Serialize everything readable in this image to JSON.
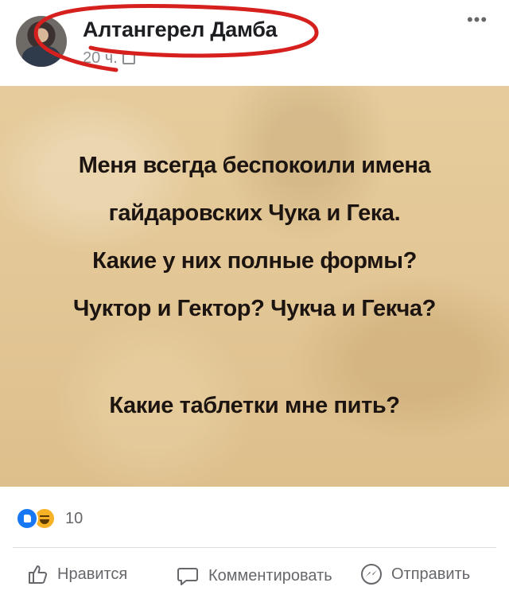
{
  "post": {
    "author": "Алтангерел Дамба",
    "meta_time": "20 ч.",
    "more_label": "•••"
  },
  "image_text": {
    "line1": "Меня всегда беспокоили имена",
    "line2": "гайдаровских Чука и Гека.",
    "line3": "Какие у них полные формы?",
    "line4": "Чуктор и Гектор? Чукча и Гекча?",
    "line5": "Какие таблетки мне пить?"
  },
  "reactions": {
    "count": "10",
    "types": [
      "like-icon",
      "haha-icon"
    ]
  },
  "actions": {
    "like_label": "Нравится",
    "comment_label": "Комментировать",
    "share_label": "Отправить"
  },
  "colors": {
    "annotation_circle": "#d6201e",
    "like_blue": "#1877f2",
    "haha_yellow": "#f7b125",
    "secondary_text": "#65676b",
    "image_background": "#e3c796"
  }
}
